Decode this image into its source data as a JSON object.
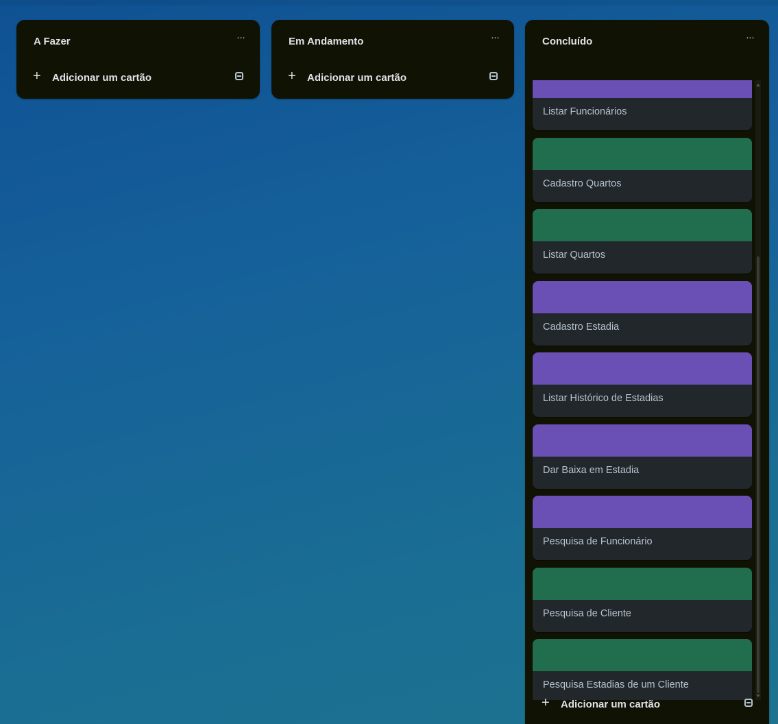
{
  "lists": [
    {
      "title": "A Fazer",
      "menu_glyph": "···",
      "add_card_label": "Adicionar um cartão"
    },
    {
      "title": "Em Andamento",
      "menu_glyph": "···",
      "add_card_label": "Adicionar um cartão"
    },
    {
      "title": "Concluído",
      "menu_glyph": "···",
      "add_card_label": "Adicionar um cartão",
      "cards": [
        {
          "title": "Listar Funcionários",
          "cover": "#6a4fb4"
        },
        {
          "title": "Cadastro Quartos",
          "cover": "#216e4e"
        },
        {
          "title": "Listar Quartos",
          "cover": "#216e4e"
        },
        {
          "title": "Cadastro Estadia",
          "cover": "#6a4fb4"
        },
        {
          "title": "Listar Histórico de Estadias",
          "cover": "#6a4fb4"
        },
        {
          "title": "Dar Baixa em Estadia",
          "cover": "#6a4fb4"
        },
        {
          "title": "Pesquisa de Funcionário",
          "cover": "#6a4fb4"
        },
        {
          "title": "Pesquisa de Cliente",
          "cover": "#216e4e"
        },
        {
          "title": "Pesquisa Estadias de um Cliente",
          "cover": "#216e4e"
        }
      ]
    }
  ],
  "icons": {
    "add": "plus-icon",
    "template": "card-template-icon",
    "menu": "more-icon"
  }
}
